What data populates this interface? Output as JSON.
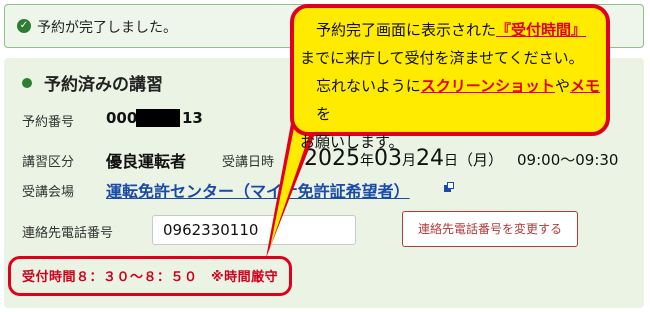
{
  "success": {
    "icon": "check-circle-icon",
    "message": "予約が完了しました。"
  },
  "reservation": {
    "section_title": "予約済みの講習",
    "number_label": "予約番号",
    "number_prefix": "000",
    "number_suffix": "13",
    "category_label": "講習区分",
    "category_value": "優良運転者",
    "date_label": "受講日時",
    "year": "2025",
    "year_unit": "年",
    "month": "03",
    "month_unit": "月",
    "day": "24",
    "day_unit": "日",
    "weekday": "（月）",
    "time": "09:00～09:30",
    "venue_label": "受講会場",
    "venue_value": "運転免許センター（マイナ免許証希望者）",
    "venue_icon": "external-link-icon",
    "phone_label": "連絡先電話番号",
    "phone_value": "0962330110",
    "change_phone_button": "連絡先電話番号を変更する",
    "reception_time": "受付時間８：３０～８：５０　※時間厳守"
  },
  "callout": {
    "line1_a": "予約完了画面に表示された",
    "line1_hl": "『受付時間』",
    "line2": "までに来庁して受付を済ませてください。",
    "line3_a": "忘れないように",
    "line3_hl1": "スクリーンショット",
    "line3_mid": "や",
    "line3_hl2": "メモ",
    "line3_b": "を",
    "line4": "お願いします。"
  },
  "colors": {
    "accent_green": "#2f7d32",
    "callout_yellow": "#ffeb00",
    "annotation_red": "#e0001b",
    "link_blue": "#1a4aa8"
  }
}
